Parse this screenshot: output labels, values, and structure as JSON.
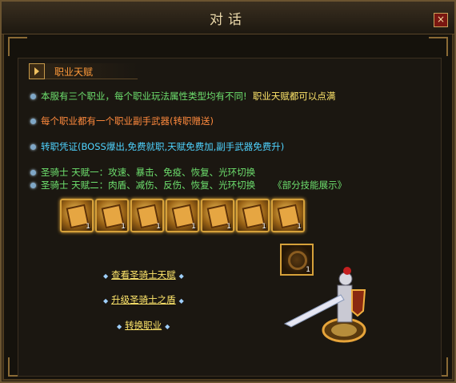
{
  "window": {
    "title": "对话",
    "close_label": "×"
  },
  "section": {
    "title": "职业天赋"
  },
  "lines": {
    "l1a": "本服有三个职业，每个职业玩法属性类型均有不同!",
    "l1b": "职业天赋都可以点满",
    "l2": "每个职业都有一个职业副手武器(转职赠送)",
    "l3": "转职凭证(BOSS爆出,免费就职,天赋免费加,副手武器免费升)",
    "l4": "圣骑士 天赋一：攻速、暴击、免疫、恢复、光环切换",
    "l5a": "圣骑士 天赋二：肉盾、减伤、反伤、恢复、光环切换",
    "l5b": "《部分技能展示》"
  },
  "items": {
    "count": [
      "1",
      "1",
      "1",
      "1",
      "1",
      "1",
      "1"
    ],
    "special_count": "1"
  },
  "links": {
    "view_talent": "查看圣骑士天赋",
    "upgrade_shield": "升级圣骑士之盾",
    "change_job": "转换职业"
  },
  "colors": {
    "gold": "#ffe66b",
    "green": "#6ee06e",
    "orange": "#ff8a3d",
    "cyan": "#4fd3ff"
  }
}
